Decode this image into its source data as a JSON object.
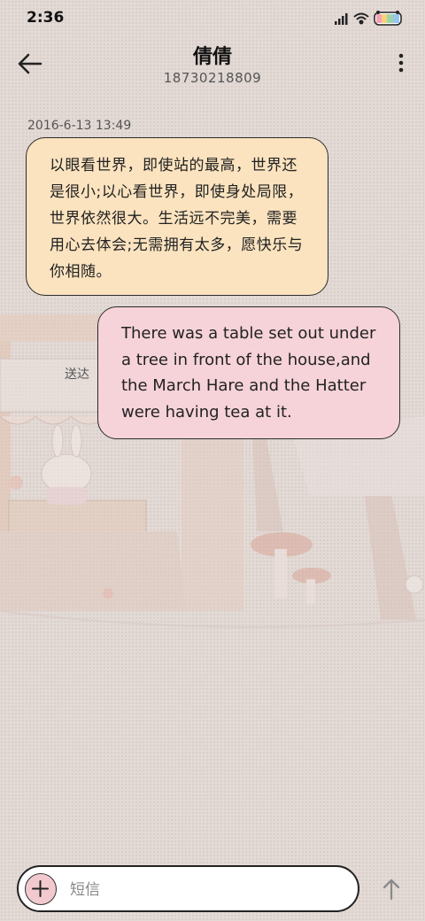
{
  "status_bar": {
    "time": "2:36",
    "icons": [
      "signal-icon",
      "wifi-icon",
      "battery-icon"
    ]
  },
  "header": {
    "contact_name": "倩倩",
    "phone_number": "18730218809"
  },
  "conversation": {
    "timestamp": "2016-6-13 13:49",
    "messages": [
      {
        "direction": "incoming",
        "text": "以眼看世界，即使站的最高，世界还是很小;以心看世界，即使身处局限，世界依然很大。生活远不完美，需要用心去体会;无需拥有太多，愿快乐与你相随。"
      },
      {
        "direction": "outgoing",
        "text": "There was a table set out under a tree in front of the house,and the March Hare and the Hatter were having tea at it.",
        "status": "送达"
      }
    ]
  },
  "composer": {
    "placeholder": "短信"
  },
  "colors": {
    "incoming_bubble": "#fbe3bf",
    "outgoing_bubble": "#f6d3d9",
    "background": "#e3dad6"
  }
}
